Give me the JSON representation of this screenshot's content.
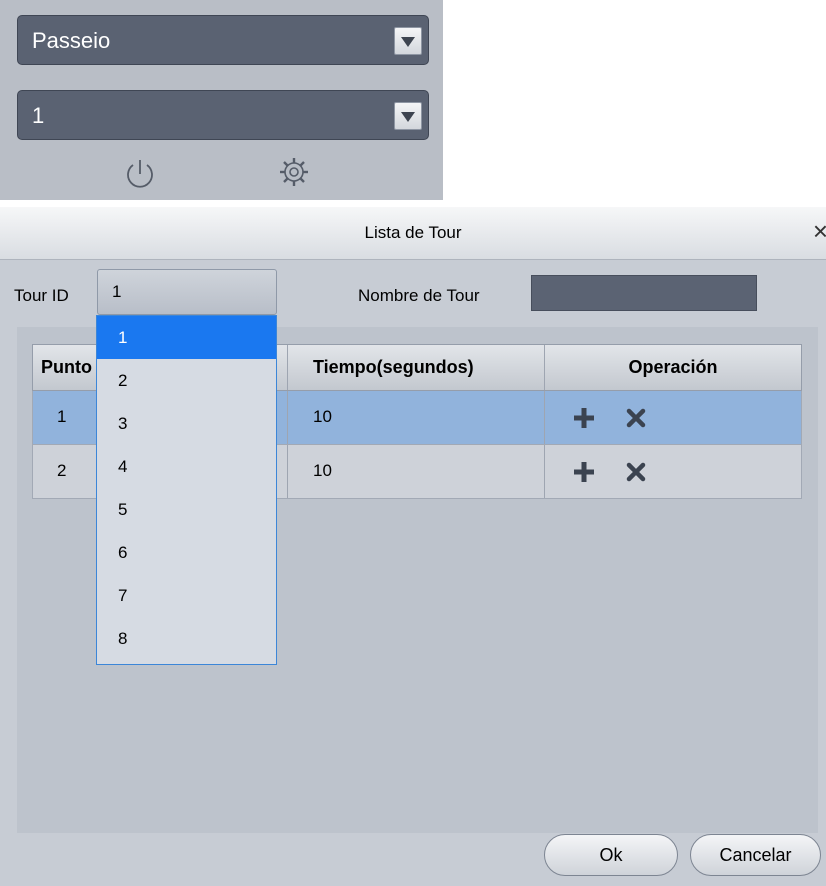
{
  "top_panel": {
    "preset_type": "Passeio",
    "preset_number": "1",
    "icons": [
      "power-icon",
      "gear-icon"
    ]
  },
  "dialog": {
    "title": "Lista de Tour",
    "close_glyph": "×",
    "tour_id_label": "Tour ID",
    "tour_id_value": "1",
    "tour_name_label": "Nombre de Tour",
    "tour_name_value": "",
    "table": {
      "headers": [
        "Punto",
        "Tiempo(segundos)",
        "Operación"
      ],
      "rows": [
        {
          "punto": "1",
          "tiempo": "10"
        },
        {
          "punto": "2",
          "tiempo": "10"
        }
      ]
    },
    "dropdown_options": [
      "1",
      "2",
      "3",
      "4",
      "5",
      "6",
      "7",
      "8"
    ],
    "dropdown_selected": "1",
    "ok_label": "Ok",
    "cancel_label": "Cancelar",
    "colors": {
      "selected_row": "#91b3dc",
      "selected_option": "#1a78f0",
      "dark_field": "#5a6272"
    }
  }
}
